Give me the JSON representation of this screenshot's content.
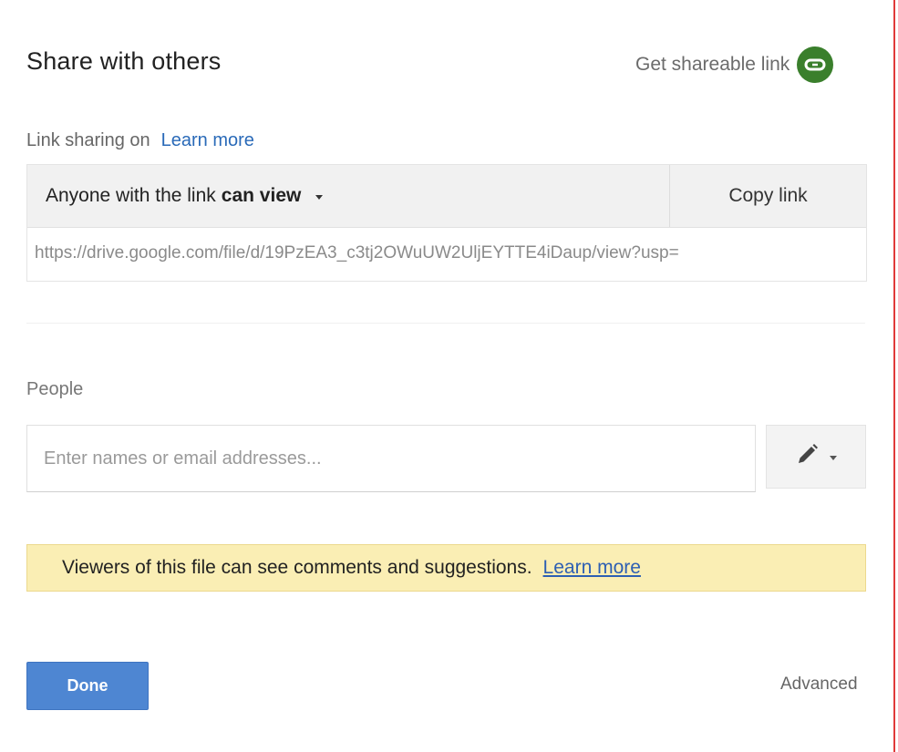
{
  "dialog": {
    "title": "Share with others",
    "get_link_label": "Get shareable link",
    "get_link_icon": "link-icon",
    "accent_green": "#3a7f2c"
  },
  "link_sharing": {
    "status_label": "Link sharing on",
    "learn_more": "Learn more",
    "access_prefix": "Anyone with the link",
    "access_level": "can view",
    "copy_link_label": "Copy link",
    "url": "https://drive.google.com/file/d/19PzEA3_c3tj2OWuUW2UljEYTTE4iDaup/view?usp="
  },
  "people": {
    "label": "People",
    "placeholder": "Enter names or email addresses...",
    "permission_icon": "pencil-icon"
  },
  "notice": {
    "text": "Viewers of this file can see comments and suggestions.",
    "learn_more": "Learn more",
    "background": "#faeeb4"
  },
  "footer": {
    "done_label": "Done",
    "advanced_label": "Advanced",
    "primary_color": "#4e86d2"
  }
}
